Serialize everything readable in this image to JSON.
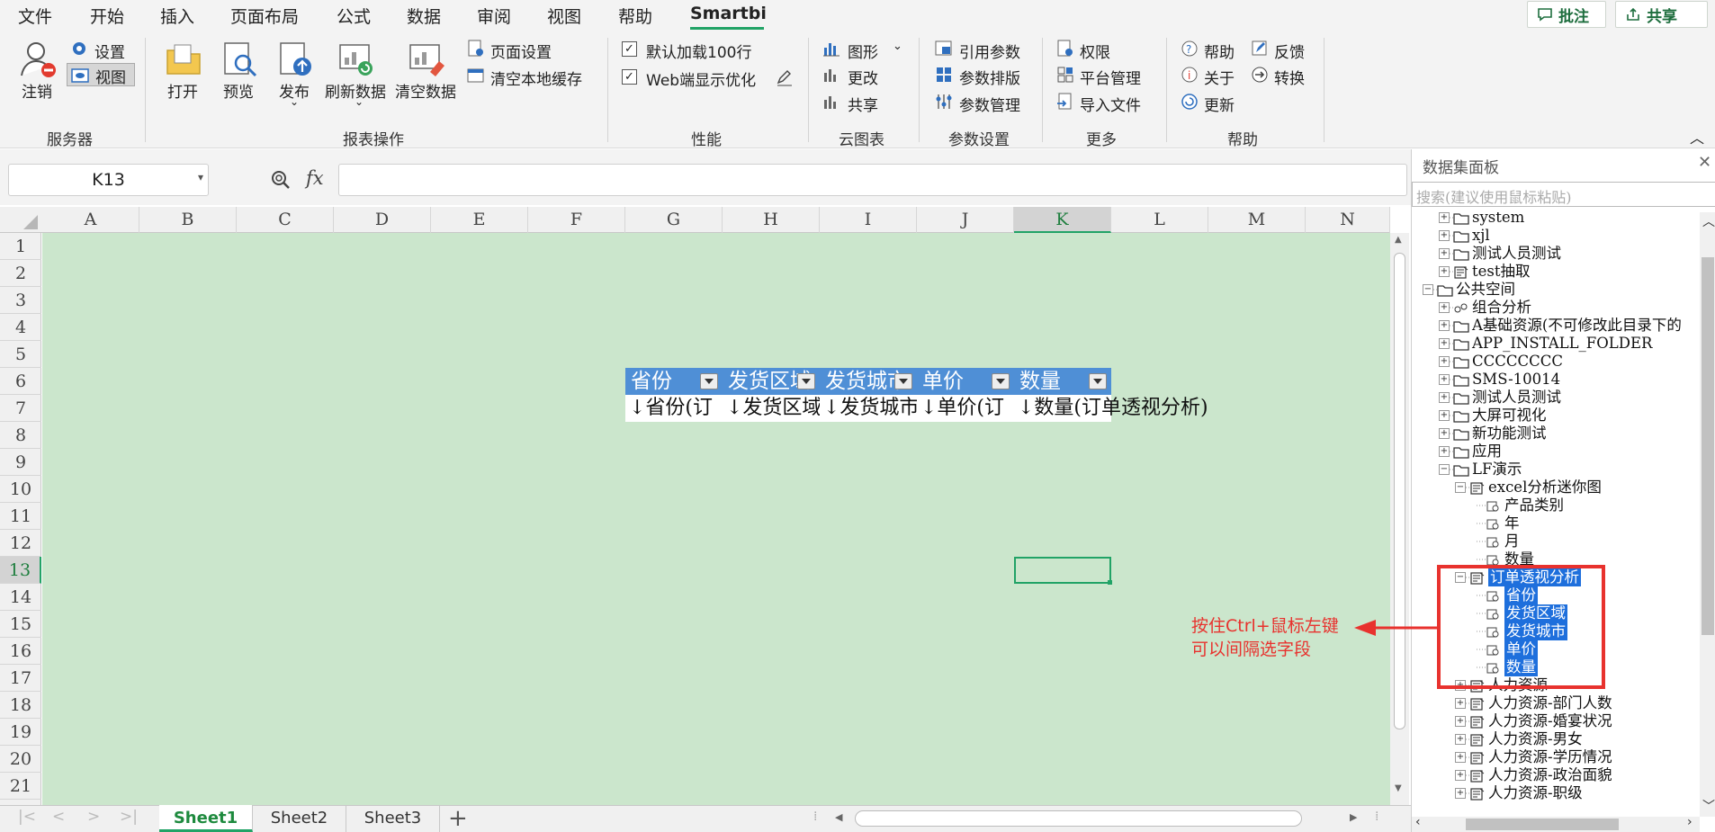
{
  "menu": {
    "items": [
      "文件",
      "开始",
      "插入",
      "页面布局",
      "公式",
      "数据",
      "审阅",
      "视图",
      "帮助",
      "Smartbi"
    ],
    "active": "Smartbi",
    "comment_button": "批注",
    "share_button": "共享"
  },
  "ribbon": {
    "server": {
      "logout": "注销",
      "settings": "设置",
      "view": "视图",
      "label": "服务器"
    },
    "report": {
      "open": "打开",
      "preview": "预览",
      "publish": "发布",
      "refresh": "刷新数据",
      "clear": "清空数据",
      "page_setup": "页面设置",
      "clear_cache": "清空本地缓存",
      "label": "报表操作"
    },
    "performance": {
      "load100": "默认加载100行",
      "web_opt": "Web端显示优化",
      "label": "性能"
    },
    "cloud_chart": {
      "graph": "图形",
      "change": "更改",
      "share": "共享",
      "label": "云图表"
    },
    "params": {
      "ref": "引用参数",
      "layout": "参数排版",
      "manage": "参数管理",
      "label": "参数设置"
    },
    "more": {
      "perm": "权限",
      "platform": "平台管理",
      "import": "导入文件",
      "label": "更多"
    },
    "help": {
      "help": "帮助",
      "feedback": "反馈",
      "about": "关于",
      "convert": "转换",
      "update": "更新",
      "label": "帮助"
    }
  },
  "formula_bar": {
    "cell_ref": "K13",
    "fx": "fx",
    "value": ""
  },
  "grid": {
    "columns": [
      "A",
      "B",
      "C",
      "D",
      "E",
      "F",
      "G",
      "H",
      "I",
      "J",
      "K",
      "L",
      "M",
      "N"
    ],
    "rows": [
      "1",
      "2",
      "3",
      "4",
      "5",
      "6",
      "7",
      "8",
      "9",
      "10",
      "11",
      "12",
      "13",
      "14",
      "15",
      "16",
      "17",
      "18",
      "19",
      "20",
      "21"
    ],
    "selected_cell": "K13",
    "table_headers": [
      "省份",
      "发货区域",
      "发货城市",
      "单价",
      "数量"
    ],
    "table_row7": [
      "↓省份(订",
      "↓发货区域",
      "↓发货城市",
      "↓单价(订",
      "↓数量(订单透视分析)"
    ]
  },
  "sheets": [
    "Sheet1",
    "Sheet2",
    "Sheet3"
  ],
  "active_sheet": "Sheet1",
  "panel": {
    "title": "数据集面板",
    "search_placeholder": "搜索(建议使用鼠标粘贴)",
    "tree": [
      {
        "label": "system",
        "icon": "folder"
      },
      {
        "label": "xjl",
        "icon": "folder"
      },
      {
        "label": "测试人员测试",
        "icon": "folder"
      },
      {
        "label": "test抽取",
        "icon": "dataset"
      },
      {
        "label": "公共空间",
        "icon": "folder"
      },
      {
        "label": "组合分析",
        "icon": "combo"
      },
      {
        "label": "A基础资源(不可修改此目录下的",
        "icon": "folder"
      },
      {
        "label": "APP_INSTALL_FOLDER",
        "icon": "folder"
      },
      {
        "label": "CCCCCCCC",
        "icon": "folder"
      },
      {
        "label": "SMS-10014",
        "icon": "folder"
      },
      {
        "label": "测试人员测试",
        "icon": "folder"
      },
      {
        "label": "大屏可视化",
        "icon": "folder"
      },
      {
        "label": "新功能测试",
        "icon": "folder"
      },
      {
        "label": "应用",
        "icon": "folder"
      },
      {
        "label": "LF演示",
        "icon": "folder"
      },
      {
        "label": "excel分析迷你图",
        "icon": "dataset"
      },
      {
        "label": "产品类别",
        "icon": "field"
      },
      {
        "label": "年",
        "icon": "field"
      },
      {
        "label": "月",
        "icon": "field"
      },
      {
        "label": "数量",
        "icon": "field"
      },
      {
        "label": "订单透视分析",
        "icon": "dataset"
      },
      {
        "label": "省份",
        "icon": "field"
      },
      {
        "label": "发货区域",
        "icon": "field"
      },
      {
        "label": "发货城市",
        "icon": "field"
      },
      {
        "label": "单价",
        "icon": "field"
      },
      {
        "label": "数量",
        "icon": "field"
      },
      {
        "label": "人力资源",
        "icon": "dataset"
      },
      {
        "label": "人力资源-部门人数",
        "icon": "dataset"
      },
      {
        "label": "人力资源-婚宴状况",
        "icon": "dataset"
      },
      {
        "label": "人力资源-男女",
        "icon": "dataset"
      },
      {
        "label": "人力资源-学历情况",
        "icon": "dataset"
      },
      {
        "label": "人力资源-政治面貌",
        "icon": "dataset"
      },
      {
        "label": "人力资源-职级",
        "icon": "dataset"
      }
    ]
  },
  "annotation": {
    "line1": "按住Ctrl+鼠标左键",
    "line2": "可以间隔选字段",
    "color": "#e8322e"
  },
  "colors": {
    "accent": "#21a366",
    "grid_bg": "#cbe6cc",
    "table_header": "#4f8fd6",
    "selection": "#1e6fdc"
  }
}
